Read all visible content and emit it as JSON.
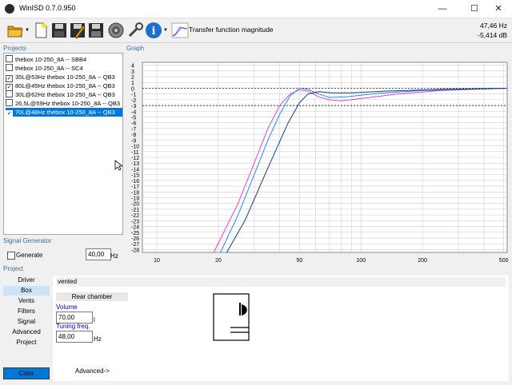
{
  "window": {
    "title": "WinISD 0.7.0.950",
    "minimize": "—",
    "maximize": "☐",
    "close": "✕"
  },
  "toolbar": {
    "transfer_label": "Transfer function magnitude",
    "freq_readout": "47,46 Hz",
    "db_readout": "-5,414 dB"
  },
  "projects": {
    "label": "Projects",
    "items": [
      {
        "label": "thebox 10-250_8A -- SBB4",
        "checked": false,
        "selected": false
      },
      {
        "label": "thebox 10-250_8A -- SC4",
        "checked": false,
        "selected": false
      },
      {
        "label": "35L@53Hz thebox 10-250_8A  -- QB3",
        "checked": true,
        "selected": false
      },
      {
        "label": "80L@45Hz thebox 10-250_8A  -- QB3",
        "checked": true,
        "selected": false
      },
      {
        "label": "30L@62Hz thebox 10-250_8A  -- QB3",
        "checked": false,
        "selected": false
      },
      {
        "label": "26,5L@59Hz thebox 10-250_8A  -- QB3",
        "checked": false,
        "selected": false
      },
      {
        "label": "70L@48Hz thebox 10-250_8A  -- QB3",
        "checked": true,
        "selected": true
      }
    ]
  },
  "graph": {
    "label": "Graph",
    "y_ticks": [
      "4",
      "3",
      "2",
      "1",
      "0",
      "-1",
      "-2",
      "-3",
      "-4",
      "-5",
      "-6",
      "-7",
      "-8",
      "-9",
      "-10",
      "-11",
      "-12",
      "-13",
      "-14",
      "-15",
      "-16",
      "-17",
      "-18",
      "-19",
      "-20",
      "-21",
      "-22",
      "-23",
      "-24",
      "-25",
      "-26",
      "-27",
      "-28"
    ],
    "x_ticks": [
      "10",
      "20",
      "50",
      "100",
      "200",
      "500"
    ]
  },
  "signal_generator": {
    "label": "Signal Generator",
    "generate_label": "Generate",
    "frequency": "40,00",
    "unit": "Hz"
  },
  "project_section": {
    "label": "Project",
    "nav": [
      "Driver",
      "Box",
      "Vents",
      "Filters",
      "Signal",
      "Advanced",
      "Project"
    ],
    "selected_nav": "Box",
    "color_button": "Color",
    "box_type": "vented",
    "rear_chamber": "Rear chamber",
    "volume_label": "Volume",
    "volume_value": "70,00",
    "volume_unit": "l",
    "tuning_label": "Tuning freq.",
    "tuning_value": "48,00",
    "tuning_unit": "Hz",
    "advanced_link": "Advanced->"
  },
  "colors": {
    "accent": "#0078d7",
    "curve_magenta": "#e040e0",
    "curve_blue": "#1f8fe0",
    "curve_navy": "#1a3a7a",
    "label_blue": "#3f6f9f"
  }
}
